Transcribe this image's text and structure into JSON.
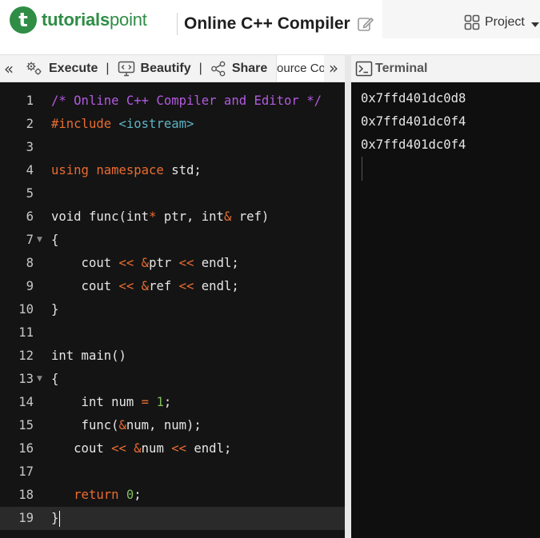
{
  "brand": {
    "logo_letter": "t",
    "name_bold": "tutorials",
    "name_light": "point",
    "color": "#2f8d46"
  },
  "header": {
    "title": "Online C++ Compiler",
    "edit_icon": "pencil-square-icon",
    "project_label": "Project",
    "project_icon": "grid-squares-icon"
  },
  "toolbar": {
    "collapse_glyph": "«",
    "execute_label": "Execute",
    "execute_icon": "gears-icon",
    "beautify_label": "Beautify",
    "beautify_icon": "code-monitor-icon",
    "share_label": "Share",
    "share_icon": "share-nodes-icon",
    "separator": "|",
    "tab_label": "Source Code",
    "expand_glyph": "»"
  },
  "terminal": {
    "header_label": "Terminal",
    "header_icon": "terminal-prompt-icon",
    "output": [
      "0x7ffd401dc0d8",
      "0x7ffd401dc0f4",
      "0x7ffd401dc0f4"
    ]
  },
  "editor": {
    "active_line": 19,
    "lines": [
      {
        "n": "1",
        "fold": false,
        "tokens": [
          [
            "c-comment",
            "/* Online C++ Compiler and Editor */"
          ]
        ]
      },
      {
        "n": "2",
        "fold": false,
        "tokens": [
          [
            "c-pre",
            "#include "
          ],
          [
            "c-str",
            "<iostream>"
          ]
        ]
      },
      {
        "n": "3",
        "fold": false,
        "tokens": []
      },
      {
        "n": "4",
        "fold": false,
        "tokens": [
          [
            "c-kw",
            "using namespace "
          ],
          [
            "",
            "std;"
          ]
        ]
      },
      {
        "n": "5",
        "fold": false,
        "tokens": []
      },
      {
        "n": "6",
        "fold": false,
        "tokens": [
          [
            "",
            "void func(int"
          ],
          [
            "c-op",
            "*"
          ],
          [
            "",
            " ptr, int"
          ],
          [
            "c-op",
            "&"
          ],
          [
            "",
            " ref)"
          ]
        ]
      },
      {
        "n": "7",
        "fold": true,
        "tokens": [
          [
            "",
            "{"
          ]
        ]
      },
      {
        "n": "8",
        "fold": false,
        "tokens": [
          [
            "",
            "    cout "
          ],
          [
            "c-op",
            "<<"
          ],
          [
            "",
            " "
          ],
          [
            "c-op",
            "&"
          ],
          [
            "",
            "ptr "
          ],
          [
            "c-op",
            "<<"
          ],
          [
            "",
            " endl;"
          ]
        ]
      },
      {
        "n": "9",
        "fold": false,
        "tokens": [
          [
            "",
            "    cout "
          ],
          [
            "c-op",
            "<<"
          ],
          [
            "",
            " "
          ],
          [
            "c-op",
            "&"
          ],
          [
            "",
            "ref "
          ],
          [
            "c-op",
            "<<"
          ],
          [
            "",
            " endl;"
          ]
        ]
      },
      {
        "n": "10",
        "fold": false,
        "tokens": [
          [
            "",
            "}"
          ]
        ]
      },
      {
        "n": "11",
        "fold": false,
        "tokens": []
      },
      {
        "n": "12",
        "fold": false,
        "tokens": [
          [
            "",
            "int main()"
          ]
        ]
      },
      {
        "n": "13",
        "fold": true,
        "tokens": [
          [
            "",
            "{"
          ]
        ]
      },
      {
        "n": "14",
        "fold": false,
        "tokens": [
          [
            "",
            "    int num "
          ],
          [
            "c-op",
            "="
          ],
          [
            "",
            " "
          ],
          [
            "c-num",
            "1"
          ],
          [
            "",
            ";"
          ]
        ]
      },
      {
        "n": "15",
        "fold": false,
        "tokens": [
          [
            "",
            "    func("
          ],
          [
            "c-op",
            "&"
          ],
          [
            "",
            "num, num);"
          ]
        ]
      },
      {
        "n": "16",
        "fold": false,
        "tokens": [
          [
            "",
            "   cout "
          ],
          [
            "c-op",
            "<<"
          ],
          [
            "",
            " "
          ],
          [
            "c-op",
            "&"
          ],
          [
            "",
            "num "
          ],
          [
            "c-op",
            "<<"
          ],
          [
            "",
            " endl;"
          ]
        ]
      },
      {
        "n": "17",
        "fold": false,
        "tokens": []
      },
      {
        "n": "18",
        "fold": false,
        "tokens": [
          [
            "",
            "   "
          ],
          [
            "c-kw",
            "return"
          ],
          [
            "",
            " "
          ],
          [
            "c-num",
            "0"
          ],
          [
            "",
            ";"
          ]
        ]
      },
      {
        "n": "19",
        "fold": false,
        "tokens": [
          [
            "",
            "}"
          ]
        ]
      }
    ]
  }
}
